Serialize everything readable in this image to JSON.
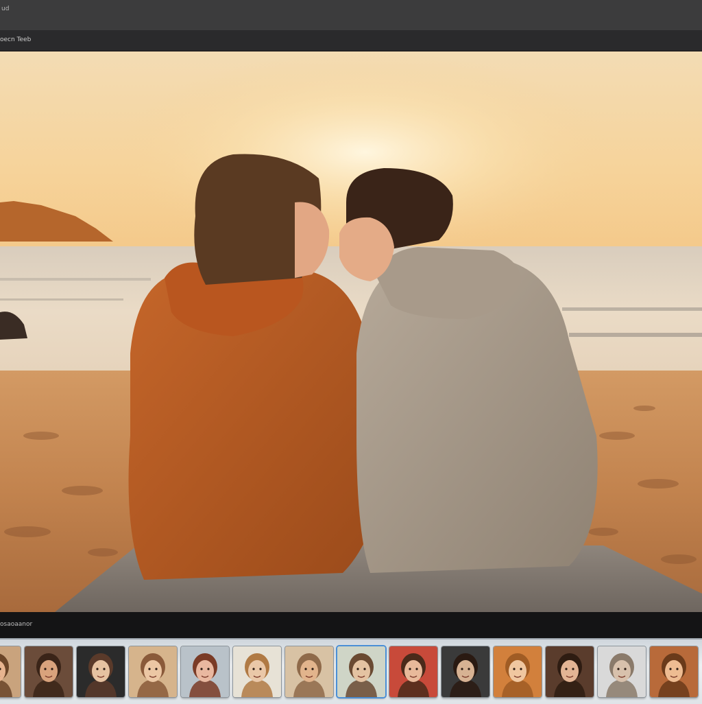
{
  "window": {
    "title": "ud"
  },
  "toolbar": {
    "label": "oecn Teeb"
  },
  "viewer": {
    "image_description_icon": "photo-beach-sunset-couple"
  },
  "statusbar": {
    "text": "osaoaanor"
  },
  "filmstrip": {
    "thumbnails": [
      {
        "bg": "#c9a37d",
        "face": "#e7b48f",
        "hair": "#6a4528"
      },
      {
        "bg": "#6b4c3a",
        "face": "#d9a27c",
        "hair": "#3a2418"
      },
      {
        "bg": "#2b2b2b",
        "face": "#e6c2a1",
        "hair": "#5a3a2a"
      },
      {
        "bg": "#d6b48c",
        "face": "#ecc7a4",
        "hair": "#8a5a3a"
      },
      {
        "bg": "#b9c2c9",
        "face": "#e9b8a0",
        "hair": "#7a3b26"
      },
      {
        "bg": "#e7e2d6",
        "face": "#eac8a8",
        "hair": "#b07a44"
      },
      {
        "bg": "#d8c2a4",
        "face": "#e2b48c",
        "hair": "#8f6a4a"
      },
      {
        "bg": "#cfd5c7",
        "face": "#e4c3a2",
        "hair": "#6a4a32"
      },
      {
        "bg": "#c84a3a",
        "face": "#e8b99a",
        "hair": "#4a2a1a"
      },
      {
        "bg": "#3a3a3a",
        "face": "#d7b293",
        "hair": "#2a1a12"
      },
      {
        "bg": "#d2803c",
        "face": "#f0c7a0",
        "hair": "#a05c24"
      },
      {
        "bg": "#5a3c2c",
        "face": "#e3b494",
        "hair": "#2e1c12"
      },
      {
        "bg": "#d9d9d9",
        "face": "#d8c1ac",
        "hair": "#8a7a6a"
      },
      {
        "bg": "#b86a3a",
        "face": "#eebc92",
        "hair": "#6a3a1a"
      }
    ],
    "active_index": 7
  }
}
